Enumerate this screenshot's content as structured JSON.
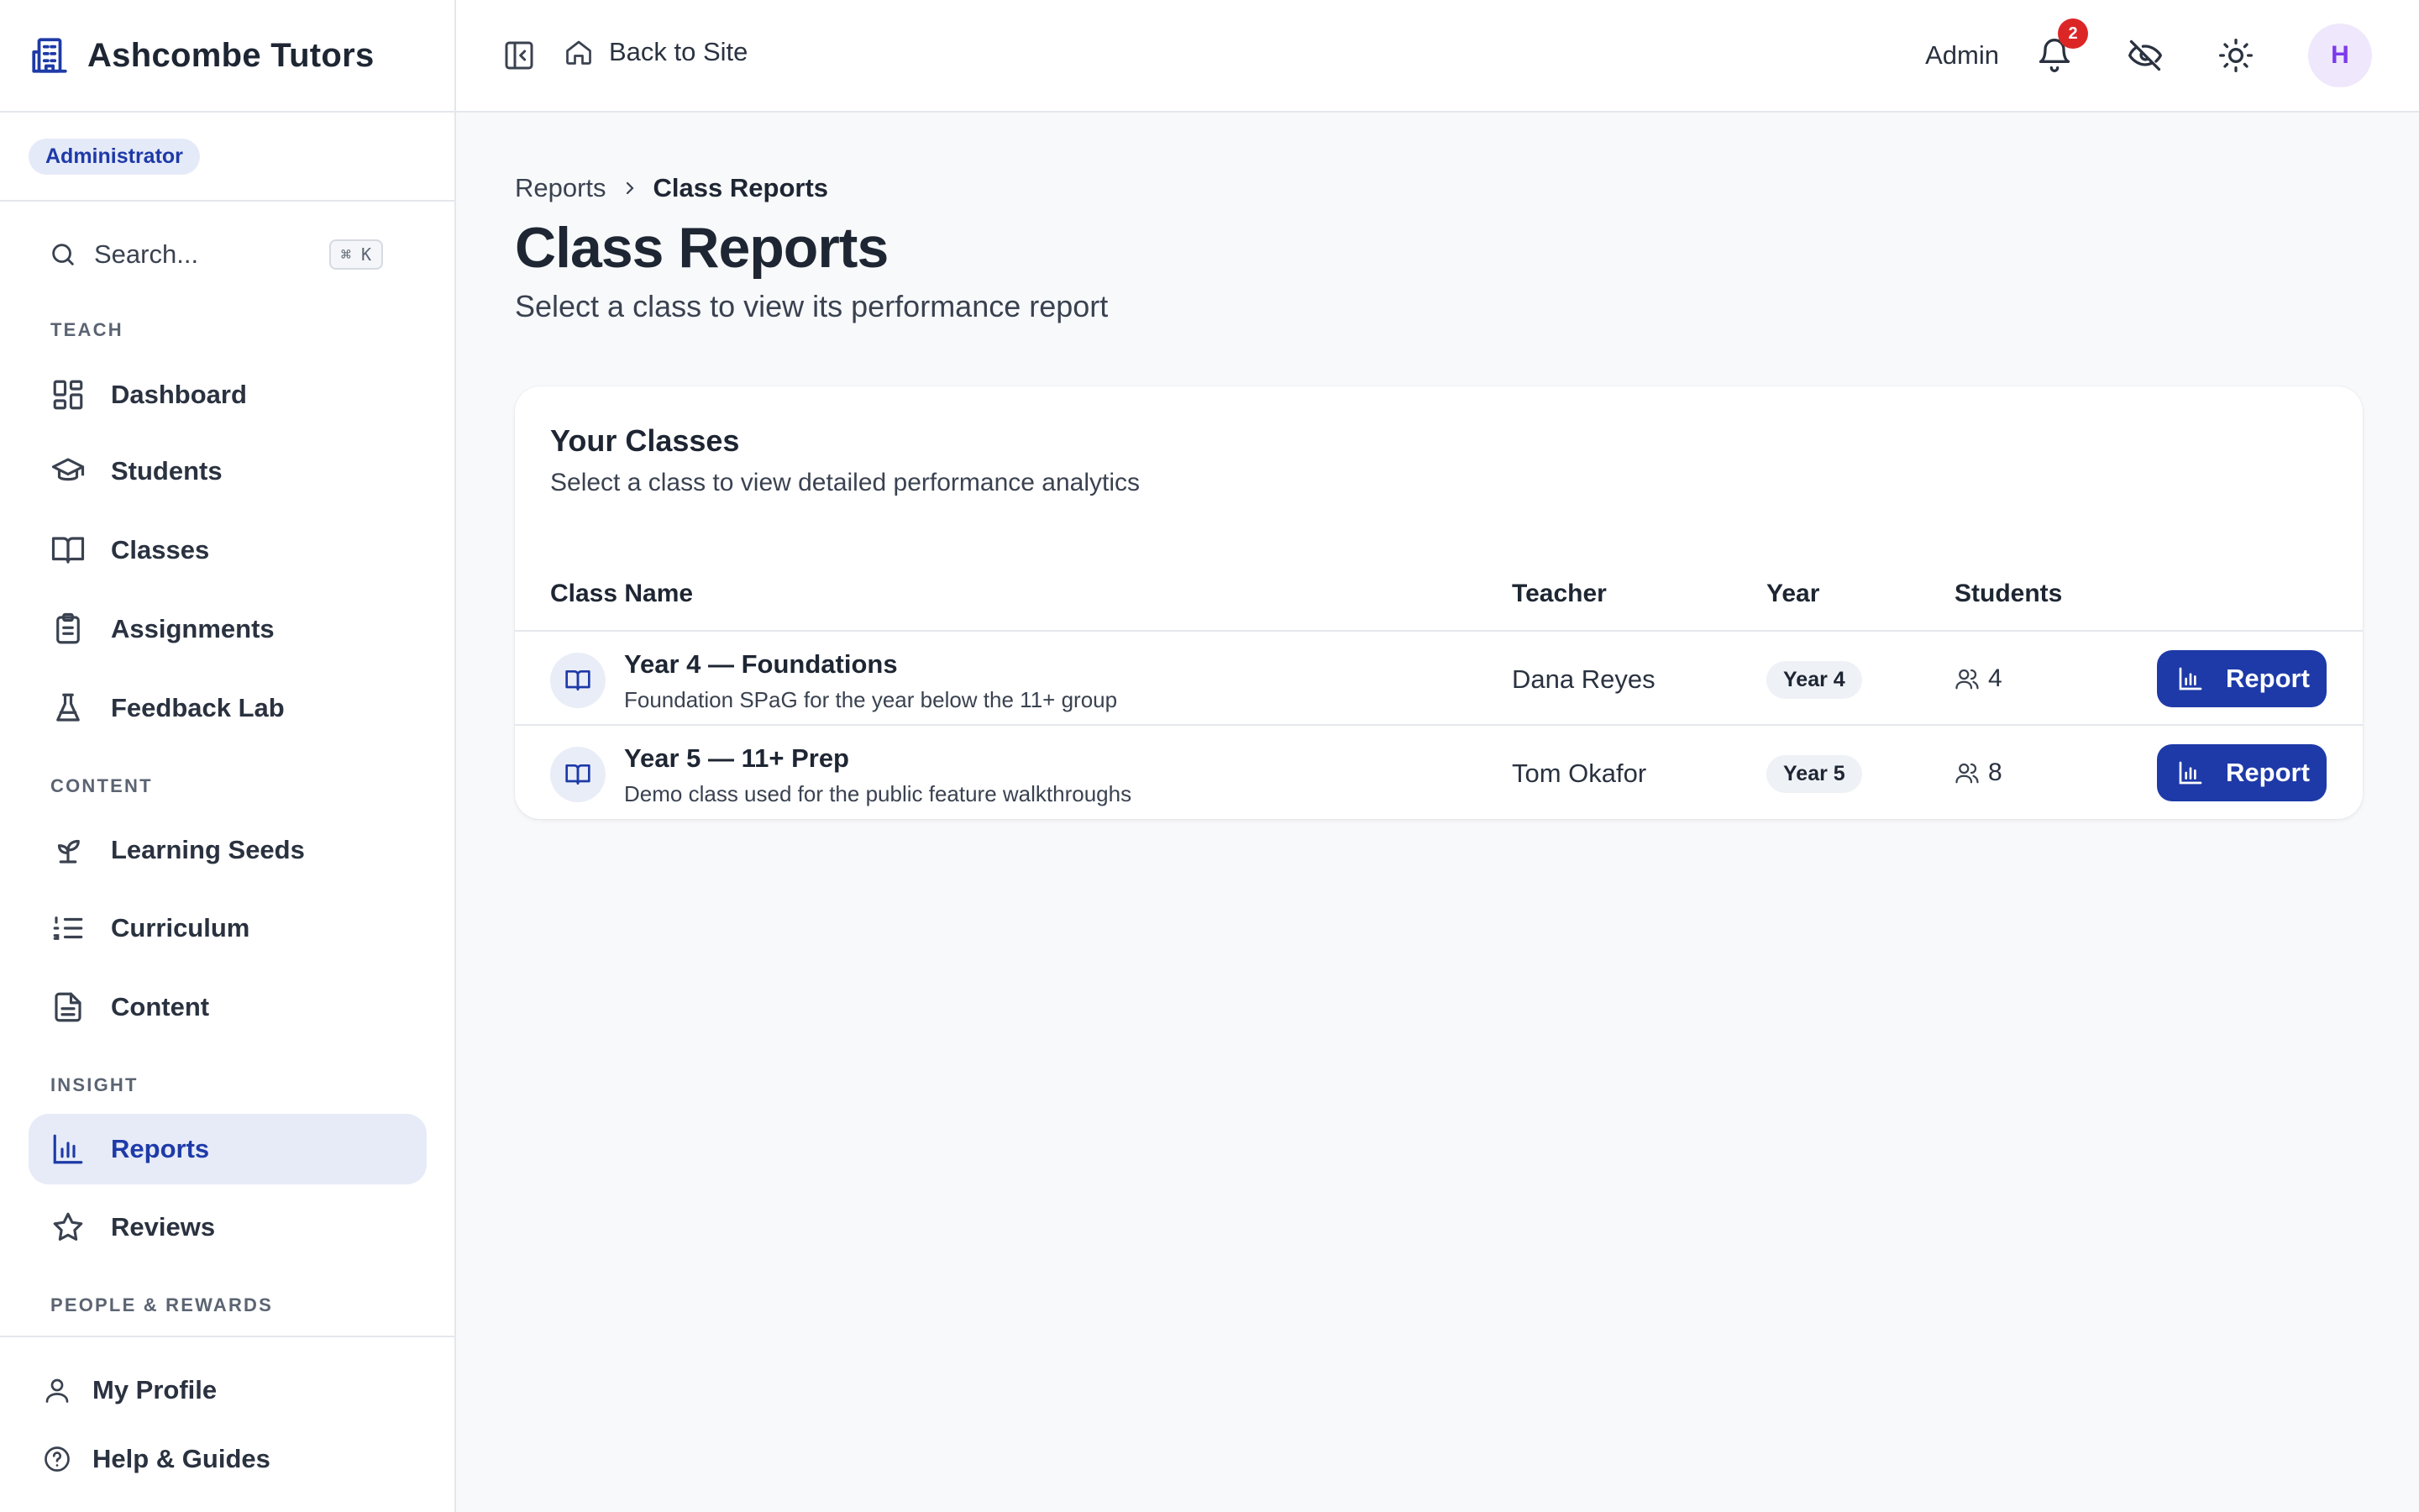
{
  "app": {
    "name": "Ashcombe Tutors",
    "role": "Administrator"
  },
  "sidebar": {
    "search": {
      "placeholder": "Search...",
      "shortcut": "⌘ K"
    },
    "sections": {
      "teach": "TEACH",
      "content": "CONTENT",
      "insight": "INSIGHT",
      "people": "PEOPLE & REWARDS"
    },
    "items": {
      "dashboard": "Dashboard",
      "students": "Students",
      "classes": "Classes",
      "assignments": "Assignments",
      "feedback_lab": "Feedback Lab",
      "learning_seeds": "Learning Seeds",
      "curriculum": "Curriculum",
      "content": "Content",
      "reports": "Reports",
      "reviews": "Reviews"
    },
    "active": "reports",
    "footer": {
      "profile": "My Profile",
      "help": "Help & Guides"
    }
  },
  "topbar": {
    "back_label": "Back to Site",
    "user_label": "Admin",
    "notification_count": "2",
    "avatar_initial": "H"
  },
  "breadcrumb": {
    "parent": "Reports",
    "current": "Class Reports"
  },
  "page": {
    "title": "Class Reports",
    "subtitle": "Select a class to view its performance report"
  },
  "card": {
    "title": "Your Classes",
    "description": "Select a class to view detailed performance analytics",
    "columns": {
      "name": "Class Name",
      "teacher": "Teacher",
      "year": "Year",
      "students": "Students"
    },
    "rows": [
      {
        "name": "Year 4 — Foundations",
        "description": "Foundation SPaG for the year below the 11+ group",
        "teacher": "Dana Reyes",
        "year": "Year 4",
        "students": "4",
        "action": "Report"
      },
      {
        "name": "Year 5 — 11+ Prep",
        "description": "Demo class used for the public feature walkthroughs",
        "teacher": "Tom Okafor",
        "year": "Year 5",
        "students": "8",
        "action": "Report"
      }
    ]
  },
  "colors": {
    "accent": "#1e3aa8",
    "badge_red": "#dc2626",
    "avatar_purple": "#7c3aed"
  }
}
